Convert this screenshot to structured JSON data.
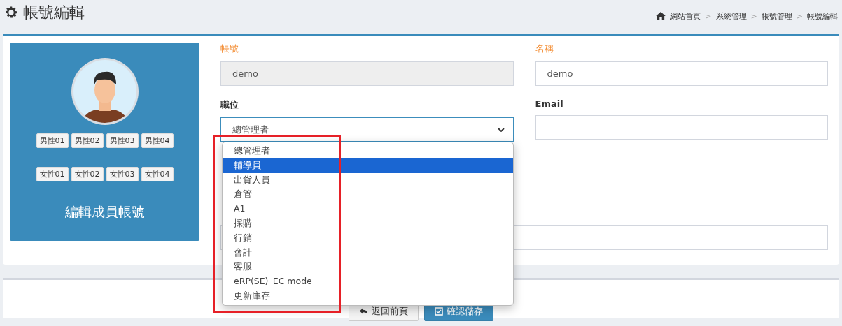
{
  "page": {
    "title": "帳號編輯"
  },
  "breadcrumb": [
    {
      "label": "網站首頁",
      "kind": "home"
    },
    {
      "label": "系統管理",
      "kind": "link"
    },
    {
      "label": "帳號管理",
      "kind": "link"
    },
    {
      "label": "帳號編輯",
      "kind": "current"
    }
  ],
  "separator": ">",
  "profile": {
    "avatar_buttons": [
      [
        "男性01",
        "男性02",
        "男性03",
        "男性04"
      ],
      [
        "女性01",
        "女性02",
        "女性03",
        "女性04"
      ]
    ],
    "caption": "編輯成員帳號"
  },
  "fields": [
    {
      "label": "帳號",
      "required": true,
      "value": "demo",
      "disabled": true
    },
    {
      "label": "名稱",
      "required": true,
      "value": "demo",
      "disabled": false
    }
  ],
  "position": {
    "label": "職位",
    "value": "總管理者",
    "options": [
      {
        "label": "總管理者",
        "highlighted": false
      },
      {
        "label": "輔導員",
        "highlighted": true
      },
      {
        "label": "出貨人員",
        "highlighted": false
      },
      {
        "label": "倉管",
        "highlighted": false
      },
      {
        "label": "A1",
        "highlighted": false
      },
      {
        "label": "採購",
        "highlighted": false
      },
      {
        "label": "行銷",
        "highlighted": false
      },
      {
        "label": "會計",
        "highlighted": false
      },
      {
        "label": "客服",
        "highlighted": false
      },
      {
        "label": "eRP(SE)_EC mode",
        "highlighted": false
      },
      {
        "label": "更新庫存",
        "highlighted": false
      }
    ]
  },
  "email": {
    "label": "Email"
  },
  "buttons": [
    {
      "label": "返回前頁",
      "kind": "back"
    },
    {
      "label": "確認儲存",
      "kind": "save"
    }
  ],
  "annotation": {
    "kind": "frame"
  }
}
